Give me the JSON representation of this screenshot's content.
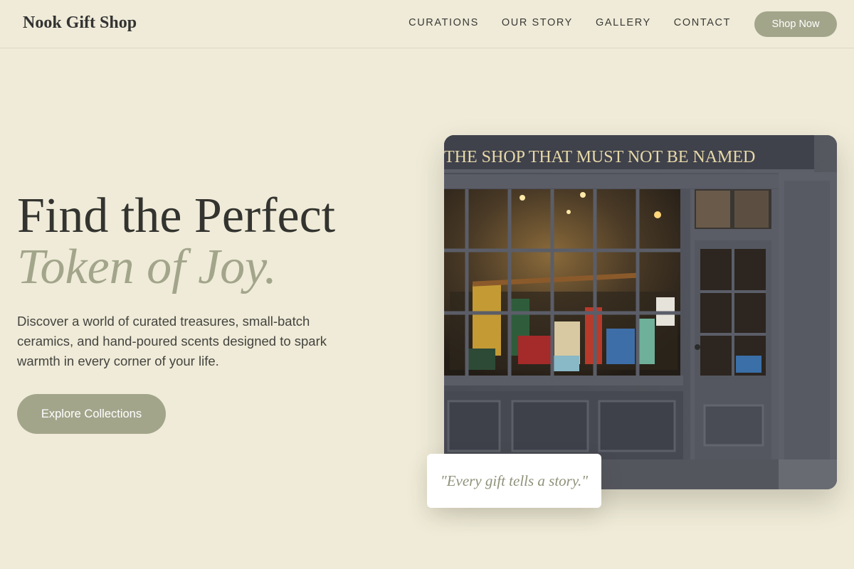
{
  "header": {
    "brand": "Nook Gift Shop",
    "nav": [
      "CURATIONS",
      "OUR STORY",
      "GALLERY",
      "CONTACT"
    ],
    "cta": "Shop Now"
  },
  "hero": {
    "title_line1": "Find the Perfect",
    "title_line2": "Token of Joy.",
    "description": "Discover a world of curated treasures, small-batch ceramics, and hand-poured scents designed to spark warmth in every corner of your life.",
    "button": "Explore Collections"
  },
  "image": {
    "sign": "THE SHOP THAT MUST NOT BE NAMED",
    "quote": "\"Every gift tells a story.\""
  },
  "colors": {
    "background": "#efebd8",
    "accent": "#a3a58b",
    "text": "#333333",
    "storefront": "#4c4e58"
  }
}
